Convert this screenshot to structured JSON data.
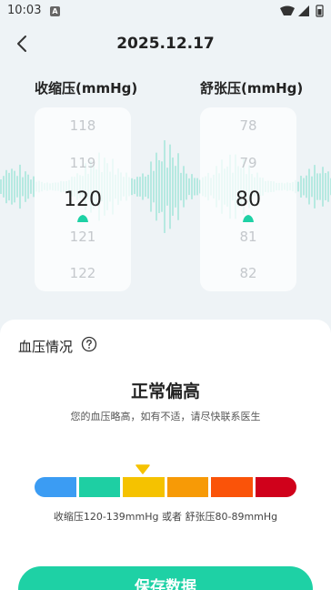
{
  "status_bar": {
    "time": "10:03",
    "notification_letter": "A",
    "icons": [
      "wifi-icon",
      "signal-icon",
      "battery-icon"
    ]
  },
  "header": {
    "title": "2025.12.17"
  },
  "pickers": {
    "systolic": {
      "label": "收缩压(mmHg)",
      "items": [
        "118",
        "119",
        "120",
        "121",
        "122"
      ],
      "selected": "120"
    },
    "diastolic": {
      "label": "舒张压(mmHg)",
      "items": [
        "78",
        "79",
        "80",
        "81",
        "82"
      ],
      "selected": "80"
    }
  },
  "card": {
    "title": "血压情况",
    "status": "正常偏高",
    "description": "您的血压略高，如有不适，请尽快联系医生",
    "scale_colors": [
      "#3b9cf3",
      "#1ecfa3",
      "#f5c200",
      "#f79a06",
      "#fa5309",
      "#d0011b"
    ],
    "active_segment": 3,
    "range": "收缩压120-139mmHg 或者 舒张压80-89mmHg"
  },
  "save_label": "保存数据",
  "colors": {
    "accent": "#1ed1a5",
    "background": "#eef3f6"
  }
}
